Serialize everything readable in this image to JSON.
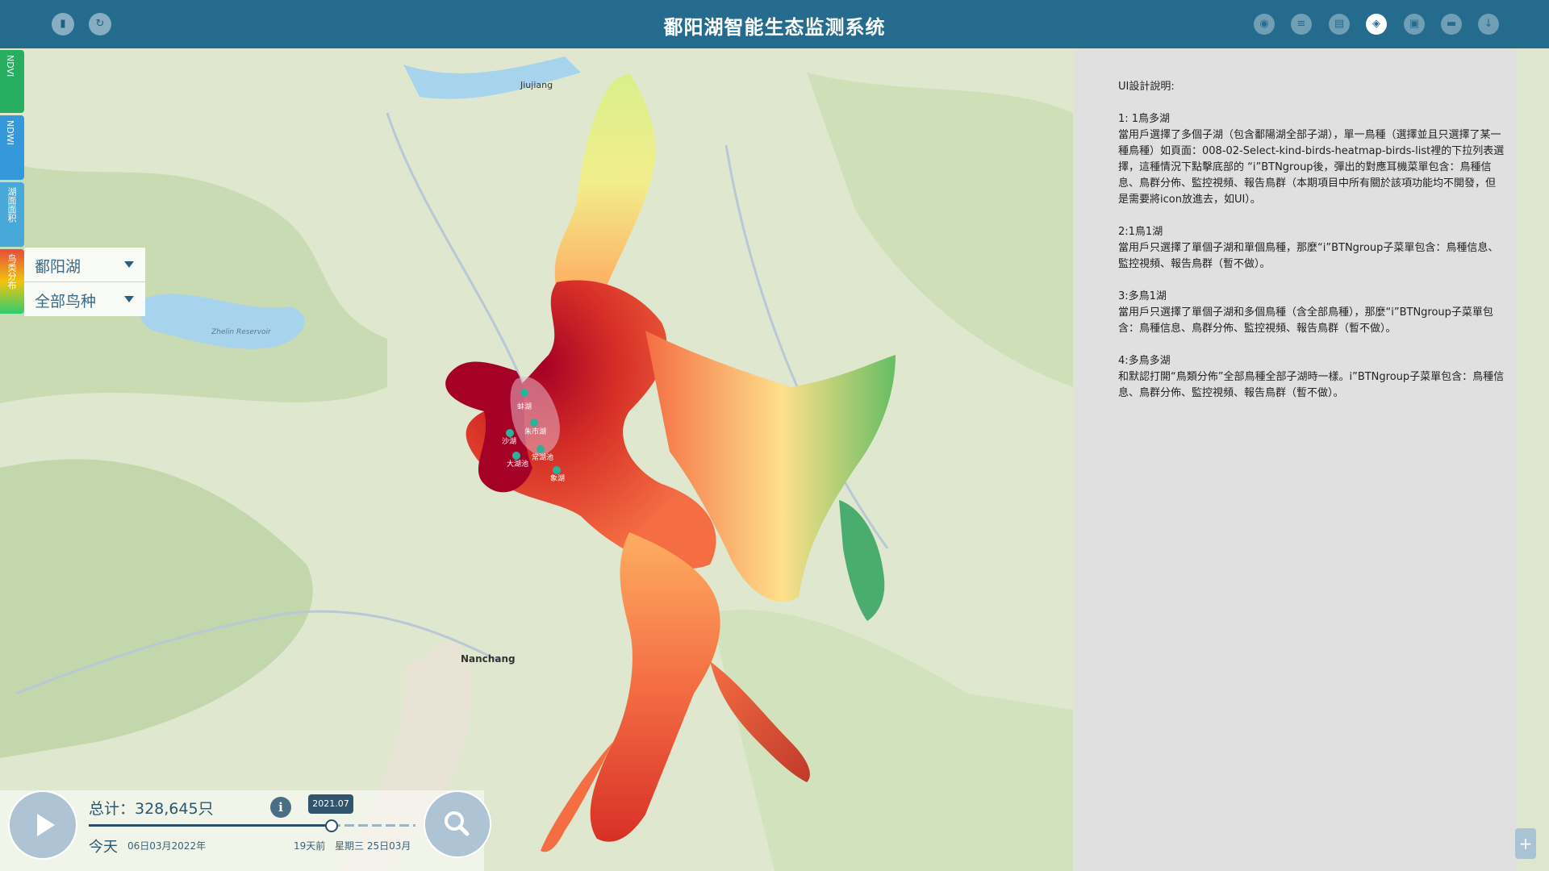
{
  "header": {
    "title": "鄱阳湖智能生态监测系统",
    "left_icons": [
      "document-icon",
      "refresh-icon"
    ],
    "right_icons": [
      "location-icon",
      "list-icon",
      "report-icon",
      "layers-icon",
      "monitor-icon",
      "chat-icon",
      "download-icon"
    ],
    "active_icon": "layers-icon"
  },
  "side_tabs": [
    {
      "label": "NDVI",
      "color": "#27ae60"
    },
    {
      "label": "NDWI",
      "color": "#3498db"
    },
    {
      "label": "湖面面积",
      "color": "#48a9d8"
    },
    {
      "label": "鸟类分布",
      "color": "#e74c3c"
    }
  ],
  "selectors": {
    "lake": "鄱阳湖",
    "species": "全部鸟种"
  },
  "map": {
    "labels": {
      "jiujiang": "Jiujiang",
      "nanchang": "Nanchang",
      "reservoir": "Zhelin Reservoir"
    },
    "sub_lakes": [
      "蚌湖",
      "朱市湖",
      "沙湖",
      "常湖池",
      "大湖池",
      "象湖"
    ]
  },
  "notes": {
    "heading": "UI設計說明:",
    "sections": [
      {
        "title": "1: 1鳥多湖",
        "body": "當用戶選擇了多個子湖（包含鄱陽湖全部子湖），單一鳥種（選擇並且只選擇了某一種鳥種）如頁面：008-02-Select-kind-birds-heatmap-birds-list裡的下拉列表選擇，這種情況下點擊底部的 “i”BTNgroup後，彈出的對應耳機菜單包含：鳥種信息、鳥群分佈、監控視頻、報告鳥群（本期項目中所有關於該項功能均不開發，但是需要將icon放進去，如UI）。"
      },
      {
        "title": "2:1鳥1湖",
        "body": "當用戶只選擇了單個子湖和單個鳥種，那麼“i”BTNgroup子菜單包含：鳥種信息、監控視頻、報告鳥群（暫不做）。"
      },
      {
        "title": "3:多鳥1湖",
        "body": "當用戶只選擇了單個子湖和多個鳥種（含全部鳥種），那麼“i”BTNgroup子菜單包含：鳥種信息、鳥群分佈、監控視頻、報告鳥群（暫不做）。"
      },
      {
        "title": "4:多鳥多湖",
        "body": "和默認打開“鳥類分佈”全部鳥種全部子湖時一樣。i”BTNgroup子菜單包含：鳥種信息、鳥群分佈、監控視頻、報告鳥群（暫不做）。"
      }
    ]
  },
  "timeline": {
    "total": "总计：328,645只",
    "date_badge": "2021.07",
    "today_label": "今天",
    "today_date": "06日03月2022年",
    "days_ago": "19天前",
    "weekday_date": "星期三 25日03月",
    "progress": 0.65
  },
  "colors": {
    "header": "#246b8e",
    "panel": "#e0e0e0",
    "heat_high": "#a50026",
    "heat_mid": "#f46d43",
    "heat_low": "#1a9850"
  }
}
